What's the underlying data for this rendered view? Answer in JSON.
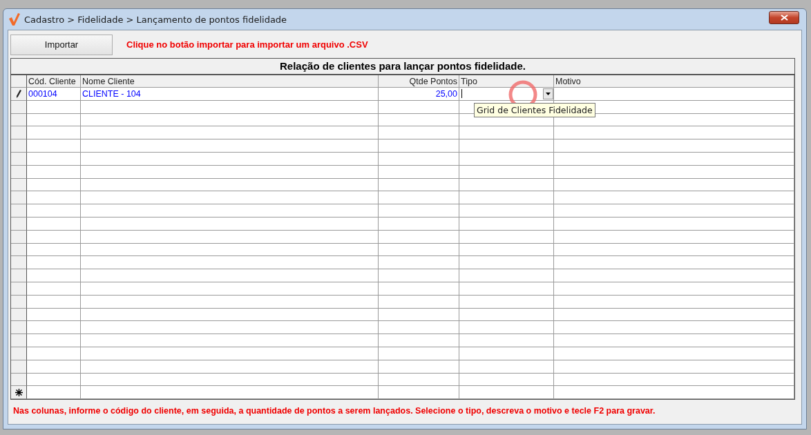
{
  "window": {
    "title": "Cadastro > Fidelidade > Lançamento de pontos fidelidade"
  },
  "toolbar": {
    "import_button": "Importar",
    "hint": "Clique no botão importar para importar um arquivo .CSV"
  },
  "grid": {
    "title": "Relação de clientes para lançar pontos fidelidade.",
    "columns": [
      {
        "label": "Cód. Cliente",
        "kind": "text"
      },
      {
        "label": "Nome Cliente",
        "kind": "text"
      },
      {
        "label": "Qtde Pontos",
        "kind": "number"
      },
      {
        "label": "Tipo",
        "kind": "dropdown"
      },
      {
        "label": "Motivo",
        "kind": "text"
      }
    ],
    "rows": [
      {
        "editing": true,
        "cells": [
          "000104",
          "CLIENTE - 104",
          "25,00",
          "",
          ""
        ]
      }
    ],
    "new_row": true,
    "tooltip": "Grid de Clientes Fidelidade"
  },
  "footer": "Nas colunas, informe o código do cliente, em seguida, a quantidade de pontos a serem lançados. Selecione o tipo, descreva o motivo e tecle F2 para gravar."
}
